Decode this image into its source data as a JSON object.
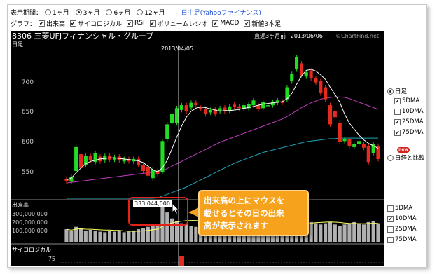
{
  "period": {
    "label": "表示期間：",
    "options": [
      {
        "label": "1ヶ月",
        "selected": false
      },
      {
        "label": "3ヶ月",
        "selected": true
      },
      {
        "label": "6ヶ月",
        "selected": false
      },
      {
        "label": "12ヶ月",
        "selected": false
      }
    ],
    "link": "日中足(Yahooファイナンス)"
  },
  "graph": {
    "label": "グラフ：",
    "options": [
      {
        "label": "出来高",
        "checked": true
      },
      {
        "label": "サイコロジカル",
        "checked": true
      },
      {
        "label": "RSI",
        "checked": true
      },
      {
        "label": "ボリュームレシオ",
        "checked": true
      },
      {
        "label": "MACD",
        "checked": true
      },
      {
        "label": "新値3本足",
        "checked": true
      }
    ]
  },
  "chart": {
    "title": "8306 三菱UFJフィナンシャル・グループ",
    "subtitle": "日足",
    "range_label": "直近3ヶ月前~2013/06/06",
    "credit": "©ChartFind.net",
    "cursor_date": "2013/04/05",
    "price_ticks": [
      "700",
      "650",
      "600",
      "550"
    ],
    "volume_label": "出来高",
    "volume_ticks": [
      "300,000,000",
      "200,000,000",
      "100,000,000"
    ],
    "volume_tip": "333,044,000",
    "psych_label": "サイコロジカル",
    "psych_tick": "75",
    "colors": {
      "up": "#22dd22",
      "down": "#e52b1f",
      "ma5": "#ffffff",
      "ma25": "#c03fc0",
      "ma75": "#1fa6b8",
      "vol": "#b0b0b0",
      "volma": "#ffff66"
    }
  },
  "side_price": {
    "radio_daily": "日足",
    "ma_options": [
      {
        "label": "5DMA",
        "checked": true
      },
      {
        "label": "10DMA",
        "checked": false
      },
      {
        "label": "25DMA",
        "checked": true
      },
      {
        "label": "75DMA",
        "checked": true
      }
    ],
    "new_badge": "new",
    "radio_compare": "日経と比較"
  },
  "side_volume": {
    "ma_options": [
      {
        "label": "5DMA",
        "checked": false
      },
      {
        "label": "10DMA",
        "checked": true
      },
      {
        "label": "25DMA",
        "checked": false
      },
      {
        "label": "75DMA",
        "checked": false
      }
    ]
  },
  "callout": {
    "lines": [
      "出来高の上にマウスを",
      "載せるとその日の出来",
      "高が表示されます"
    ]
  },
  "chart_data": {
    "type": "candlestick",
    "title": "8306 三菱UFJフィナンシャル・グループ",
    "subtitle": "日足",
    "ylim": [
      520,
      745
    ],
    "price_ticks": [
      700,
      650,
      600,
      550
    ],
    "candles": [
      {
        "o": 537,
        "c": 533
      },
      {
        "o": 532,
        "c": 540
      },
      {
        "o": 550,
        "c": 590
      },
      {
        "o": 578,
        "c": 555
      },
      {
        "o": 560,
        "c": 575
      },
      {
        "o": 575,
        "c": 568
      },
      {
        "o": 565,
        "c": 580
      },
      {
        "o": 574,
        "c": 566
      },
      {
        "o": 568,
        "c": 575
      },
      {
        "o": 576,
        "c": 569
      },
      {
        "o": 569,
        "c": 573
      },
      {
        "o": 574,
        "c": 568
      },
      {
        "o": 566,
        "c": 570
      },
      {
        "o": 570,
        "c": 566
      },
      {
        "o": 566,
        "c": 570
      },
      {
        "o": 570,
        "c": 560
      },
      {
        "o": 560,
        "c": 550
      },
      {
        "o": 557,
        "c": 542
      },
      {
        "o": 538,
        "c": 552
      },
      {
        "o": 550,
        "c": 545
      },
      {
        "o": 548,
        "c": 600
      },
      {
        "o": 603,
        "c": 628
      },
      {
        "o": 630,
        "c": 645
      },
      {
        "o": 630,
        "c": 655
      },
      {
        "o": 652,
        "c": 660
      },
      {
        "o": 660,
        "c": 650
      },
      {
        "o": 656,
        "c": 664
      },
      {
        "o": 664,
        "c": 660
      },
      {
        "o": 656,
        "c": 654
      },
      {
        "o": 654,
        "c": 645
      },
      {
        "o": 648,
        "c": 652
      },
      {
        "o": 653,
        "c": 645
      },
      {
        "o": 650,
        "c": 655
      },
      {
        "o": 656,
        "c": 650
      },
      {
        "o": 651,
        "c": 658
      },
      {
        "o": 661,
        "c": 658
      },
      {
        "o": 658,
        "c": 655
      },
      {
        "o": 654,
        "c": 660
      },
      {
        "o": 655,
        "c": 662
      },
      {
        "o": 660,
        "c": 668
      },
      {
        "o": 660,
        "c": 653
      },
      {
        "o": 655,
        "c": 665
      },
      {
        "o": 660,
        "c": 660
      },
      {
        "o": 660,
        "c": 665
      },
      {
        "o": 664,
        "c": 668
      },
      {
        "o": 666,
        "c": 664
      },
      {
        "o": 670,
        "c": 690
      },
      {
        "o": 700,
        "c": 712
      },
      {
        "o": 720,
        "c": 740
      },
      {
        "o": 730,
        "c": 710
      },
      {
        "o": 708,
        "c": 715
      },
      {
        "o": 718,
        "c": 705
      },
      {
        "o": 705,
        "c": 698
      },
      {
        "o": 700,
        "c": 680
      },
      {
        "o": 690,
        "c": 670
      },
      {
        "o": 660,
        "c": 628
      },
      {
        "o": 650,
        "c": 640
      },
      {
        "o": 630,
        "c": 598
      },
      {
        "o": 600,
        "c": 603
      },
      {
        "o": 603,
        "c": 592
      },
      {
        "o": 590,
        "c": 595
      },
      {
        "o": 595,
        "c": 600
      },
      {
        "o": 595,
        "c": 589
      },
      {
        "o": 592,
        "c": 565
      },
      {
        "o": 580,
        "c": 595
      },
      {
        "o": 592,
        "c": 570
      }
    ],
    "ma5": [
      535,
      538,
      547,
      555,
      562,
      566,
      568,
      570,
      571,
      572,
      572,
      571,
      570,
      569,
      568,
      567,
      564,
      558,
      552,
      549,
      555,
      568,
      587,
      607,
      625,
      640,
      650,
      655,
      657,
      656,
      654,
      652,
      650,
      651,
      651,
      652,
      653,
      655,
      656,
      658,
      660,
      662,
      663,
      664,
      665,
      666,
      671,
      680,
      695,
      709,
      718,
      720,
      717,
      711,
      703,
      690,
      678,
      665,
      645,
      630,
      620,
      610,
      602,
      596,
      592,
      588
    ],
    "ma25": [
      530,
      531,
      532,
      533,
      534,
      535,
      536,
      537,
      538,
      539,
      540,
      541,
      542,
      543,
      544,
      545,
      546,
      547,
      548,
      549,
      551,
      554,
      558,
      562,
      566,
      570,
      574,
      578,
      582,
      586,
      590,
      594,
      598,
      601,
      604,
      607,
      610,
      613,
      616,
      619,
      622,
      625,
      628,
      631,
      634,
      637,
      641,
      646,
      651,
      656,
      660,
      664,
      667,
      670,
      672,
      673,
      674,
      674,
      673,
      671,
      668,
      665,
      662,
      659,
      656,
      653
    ],
    "ma75": [
      467,
      469,
      471,
      473,
      475,
      477,
      479,
      481,
      483,
      485,
      487,
      489,
      491,
      493,
      495,
      497,
      499,
      501,
      503,
      505,
      508,
      511,
      514,
      517,
      520,
      523,
      527,
      531,
      535,
      539,
      543,
      547,
      551,
      555,
      559,
      563,
      566,
      569,
      572,
      575,
      578,
      581,
      583,
      585,
      587,
      589,
      591,
      593,
      595,
      597,
      599,
      600,
      601,
      602,
      603,
      604,
      604,
      605,
      605,
      605,
      605,
      605,
      605,
      605,
      605,
      605
    ],
    "volume_ticks": [
      300000000,
      200000000,
      100000000
    ],
    "volume_ylim": [
      0,
      350000000
    ],
    "volume": [
      110,
      95,
      130,
      120,
      100,
      105,
      95,
      90,
      85,
      100,
      90,
      95,
      85,
      90,
      100,
      110,
      120,
      130,
      150,
      140,
      333,
      250,
      200,
      180,
      160,
      150,
      140,
      130,
      120,
      130,
      120,
      110,
      100,
      110,
      105,
      100,
      110,
      120,
      100,
      95,
      100,
      110,
      120,
      130,
      140,
      150,
      170,
      160,
      200,
      190,
      180,
      170,
      160,
      150,
      160,
      170,
      150,
      140,
      150,
      160,
      170,
      160,
      150,
      170,
      180,
      160
    ]
  }
}
